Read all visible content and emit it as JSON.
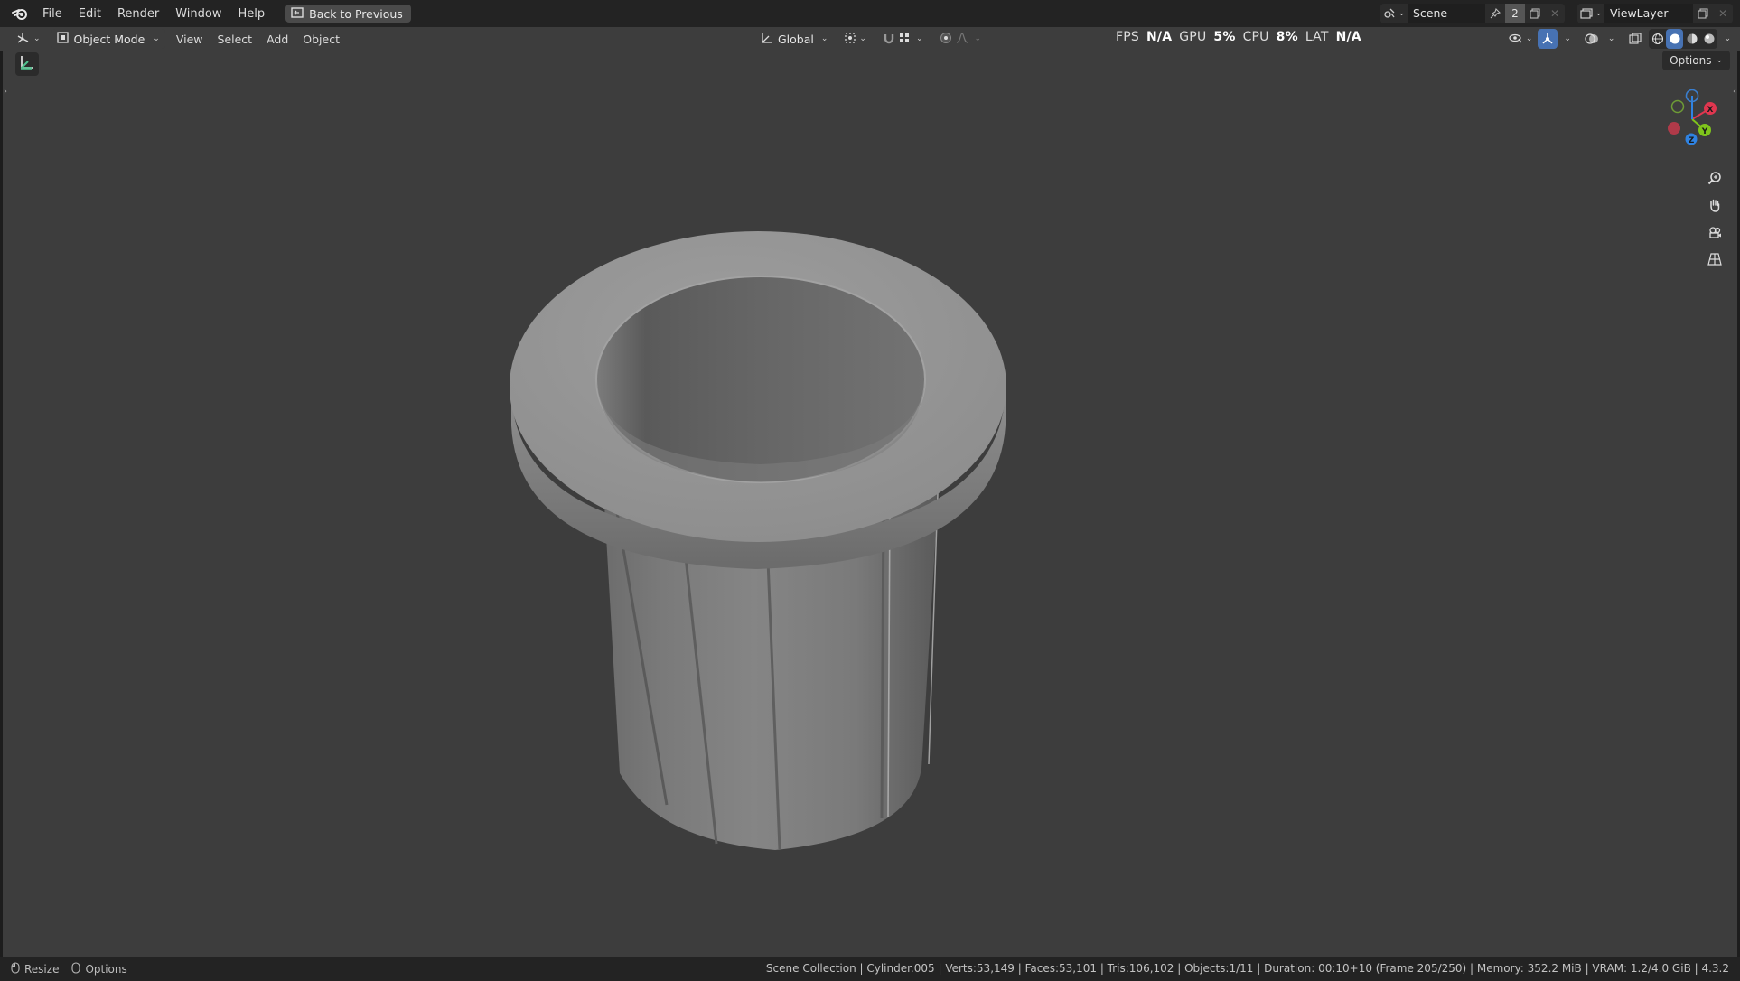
{
  "menubar": {
    "items": [
      "File",
      "Edit",
      "Render",
      "Window",
      "Help"
    ],
    "back_button": "Back to Previous",
    "scene_name": "Scene",
    "scene_users": "2",
    "view_layer": "ViewLayer"
  },
  "header": {
    "mode": "Object Mode",
    "menus": [
      "View",
      "Select",
      "Add",
      "Object"
    ],
    "transform_orientation": "Global",
    "stats": {
      "fps_label": "FPS",
      "fps_value": "N/A",
      "gpu_label": "GPU",
      "gpu_value": "5%",
      "cpu_label": "CPU",
      "cpu_value": "8%",
      "lat_label": "LAT",
      "lat_value": "N/A"
    }
  },
  "viewport": {
    "options_label": "Options",
    "gizmo_axes": {
      "x": "X",
      "y": "Y",
      "z": "Z"
    },
    "axis_colors": {
      "x": "#e0364f",
      "y": "#7fc41c",
      "z": "#2f83e3"
    }
  },
  "statusbar": {
    "left_items": [
      "Resize",
      "Options"
    ],
    "stats": "Scene Collection | Cylinder.005 | Verts:53,149 | Faces:53,101 | Tris:106,102 | Objects:1/11 | Duration: 00:10+10 (Frame 205/250) | Memory: 352.2 MiB | VRAM: 1.2/4.0 GiB | 4.3.2"
  }
}
